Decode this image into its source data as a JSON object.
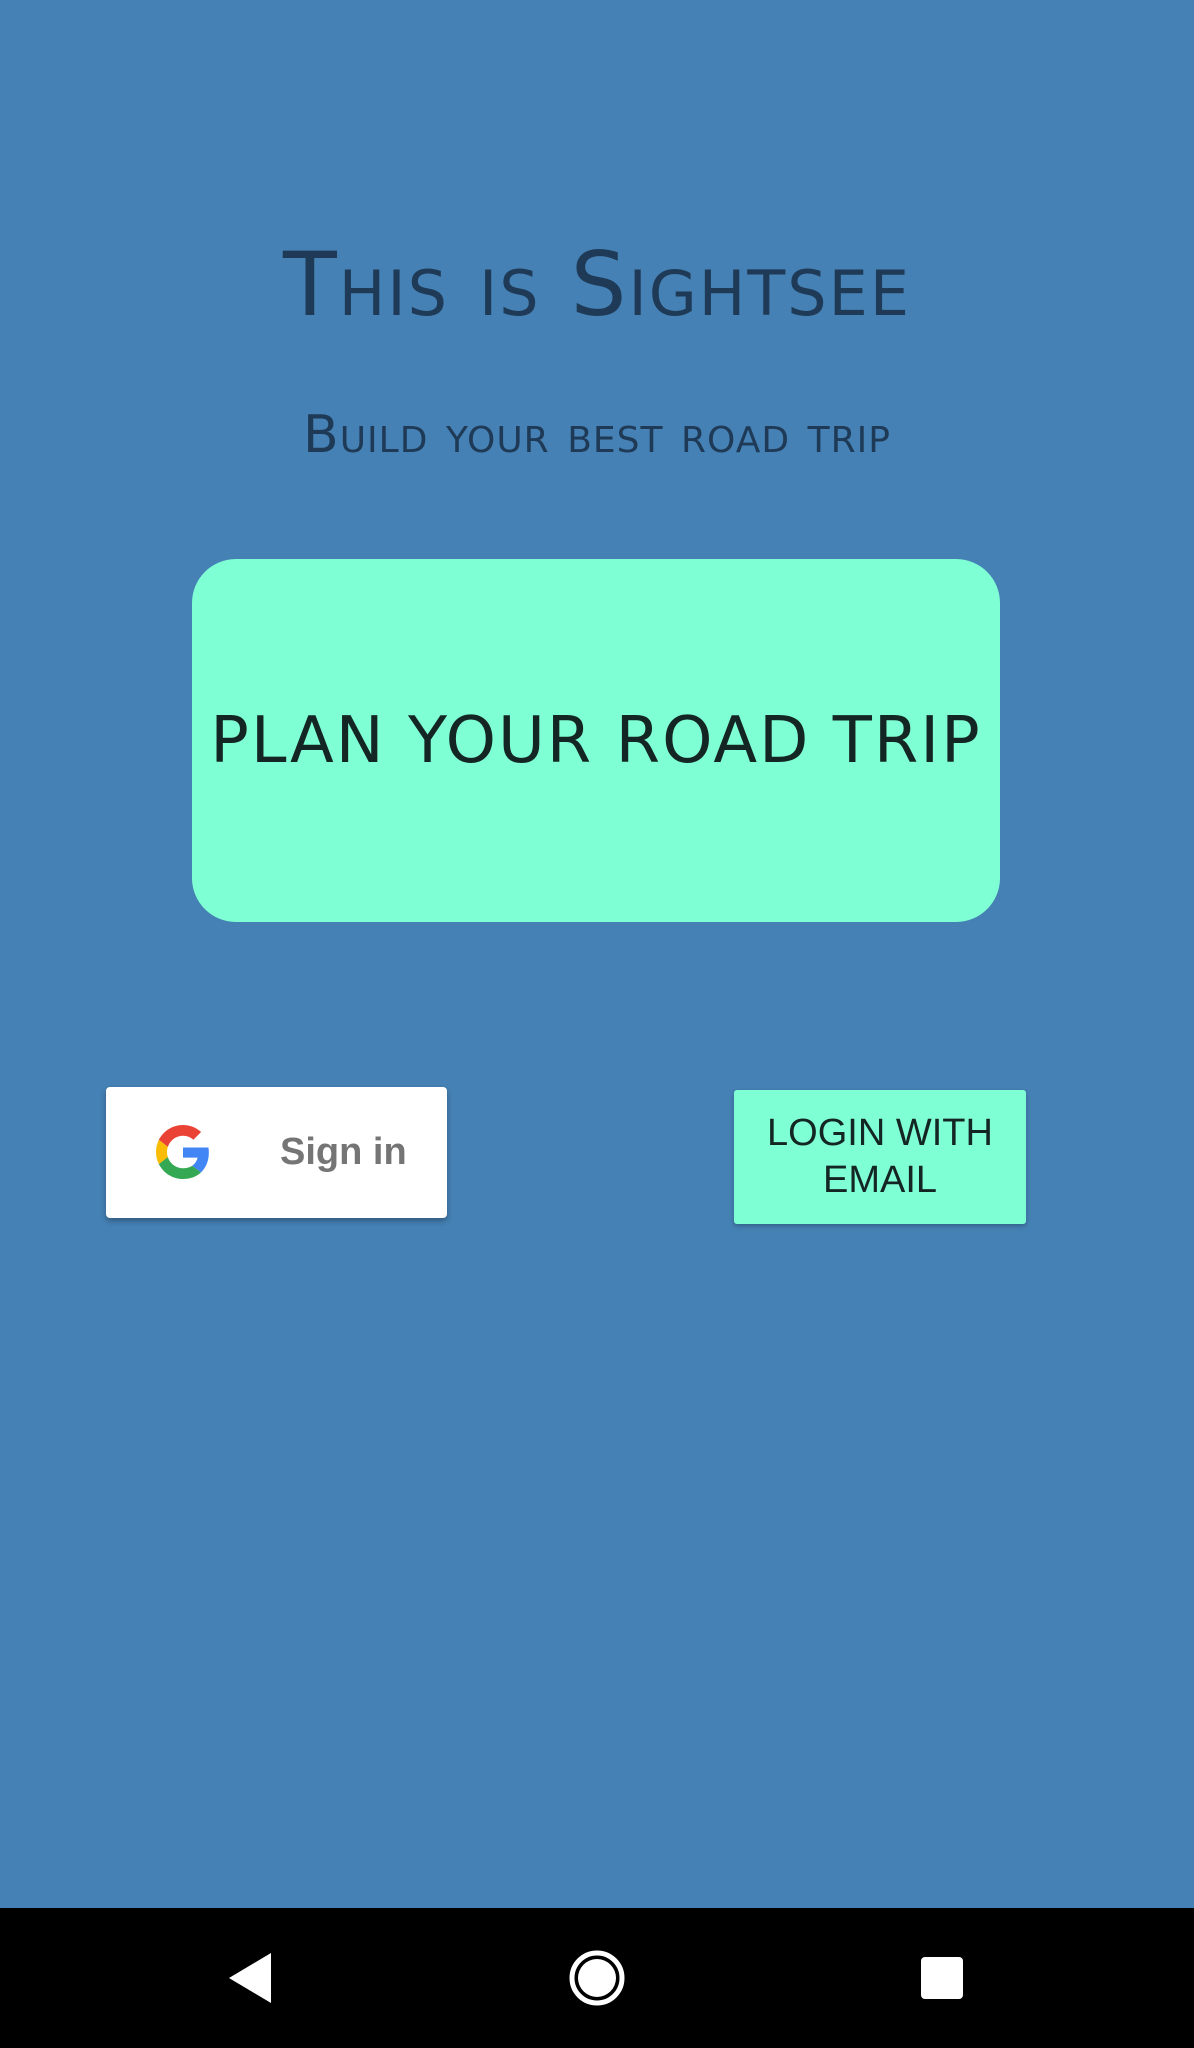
{
  "header": {
    "title": "This is Sightsee",
    "subtitle": "Build your best road trip"
  },
  "main": {
    "plan_button_label": "PLAN YOUR ROAD TRIP"
  },
  "auth": {
    "google_sign_in_label": "Sign in",
    "google_icon": "google-g-icon",
    "email_login_label": "LOGIN WITH EMAIL"
  },
  "navbar": {
    "back_icon": "back-triangle-icon",
    "home_icon": "home-circle-icon",
    "recents_icon": "recents-square-icon"
  },
  "colors": {
    "background": "#4581B4",
    "accent": "#7FFFD4",
    "title_text": "#1F3A56",
    "navbar": "#000000"
  }
}
